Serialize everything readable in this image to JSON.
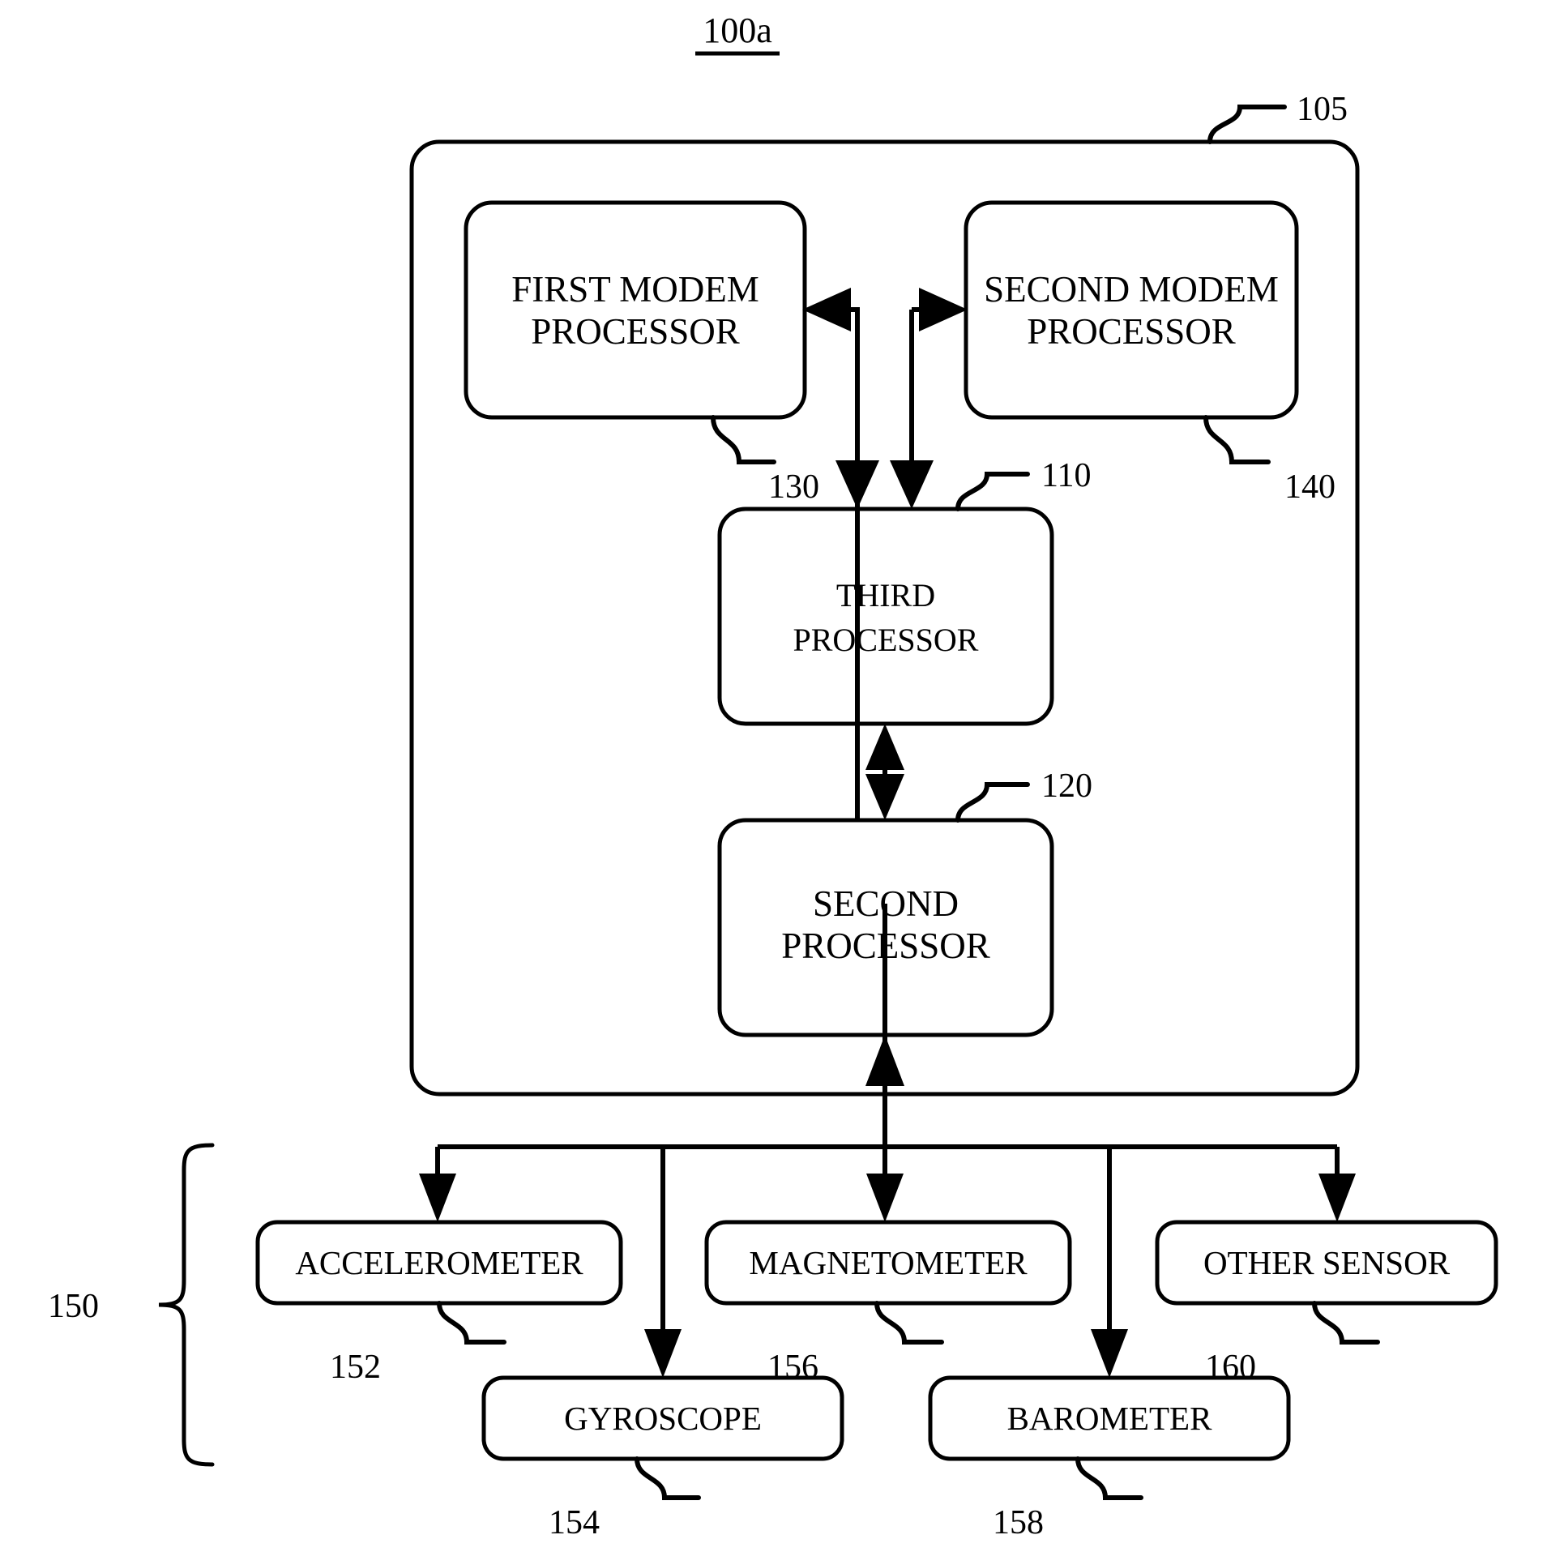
{
  "figure": {
    "title": "100a",
    "title_underlined": true
  },
  "blocks": {
    "outer_system": {
      "ref": "105",
      "label": ""
    },
    "first_modem": {
      "line1": "FIRST MODEM",
      "line2": "PROCESSOR",
      "ref": "130"
    },
    "second_modem": {
      "line1": "SECOND MODEM",
      "line2": "PROCESSOR",
      "ref": "140"
    },
    "third_processor": {
      "line1": "THIRD",
      "line2": "PROCESSOR",
      "ref": "110"
    },
    "second_processor": {
      "line1": "SECOND",
      "line2": "PROCESSOR",
      "ref": "120"
    }
  },
  "sensors": {
    "group_ref": "150",
    "items": [
      {
        "label": "ACCELEROMETER",
        "ref": "152"
      },
      {
        "label": "GYROSCOPE",
        "ref": "154"
      },
      {
        "label": "MAGNETOMETER",
        "ref": "156"
      },
      {
        "label": "BAROMETER",
        "ref": "158"
      },
      {
        "label": "OTHER SENSOR",
        "ref": "160"
      }
    ]
  },
  "colors": {
    "stroke": "#000000",
    "fill": "#ffffff",
    "background": "#ffffff"
  }
}
